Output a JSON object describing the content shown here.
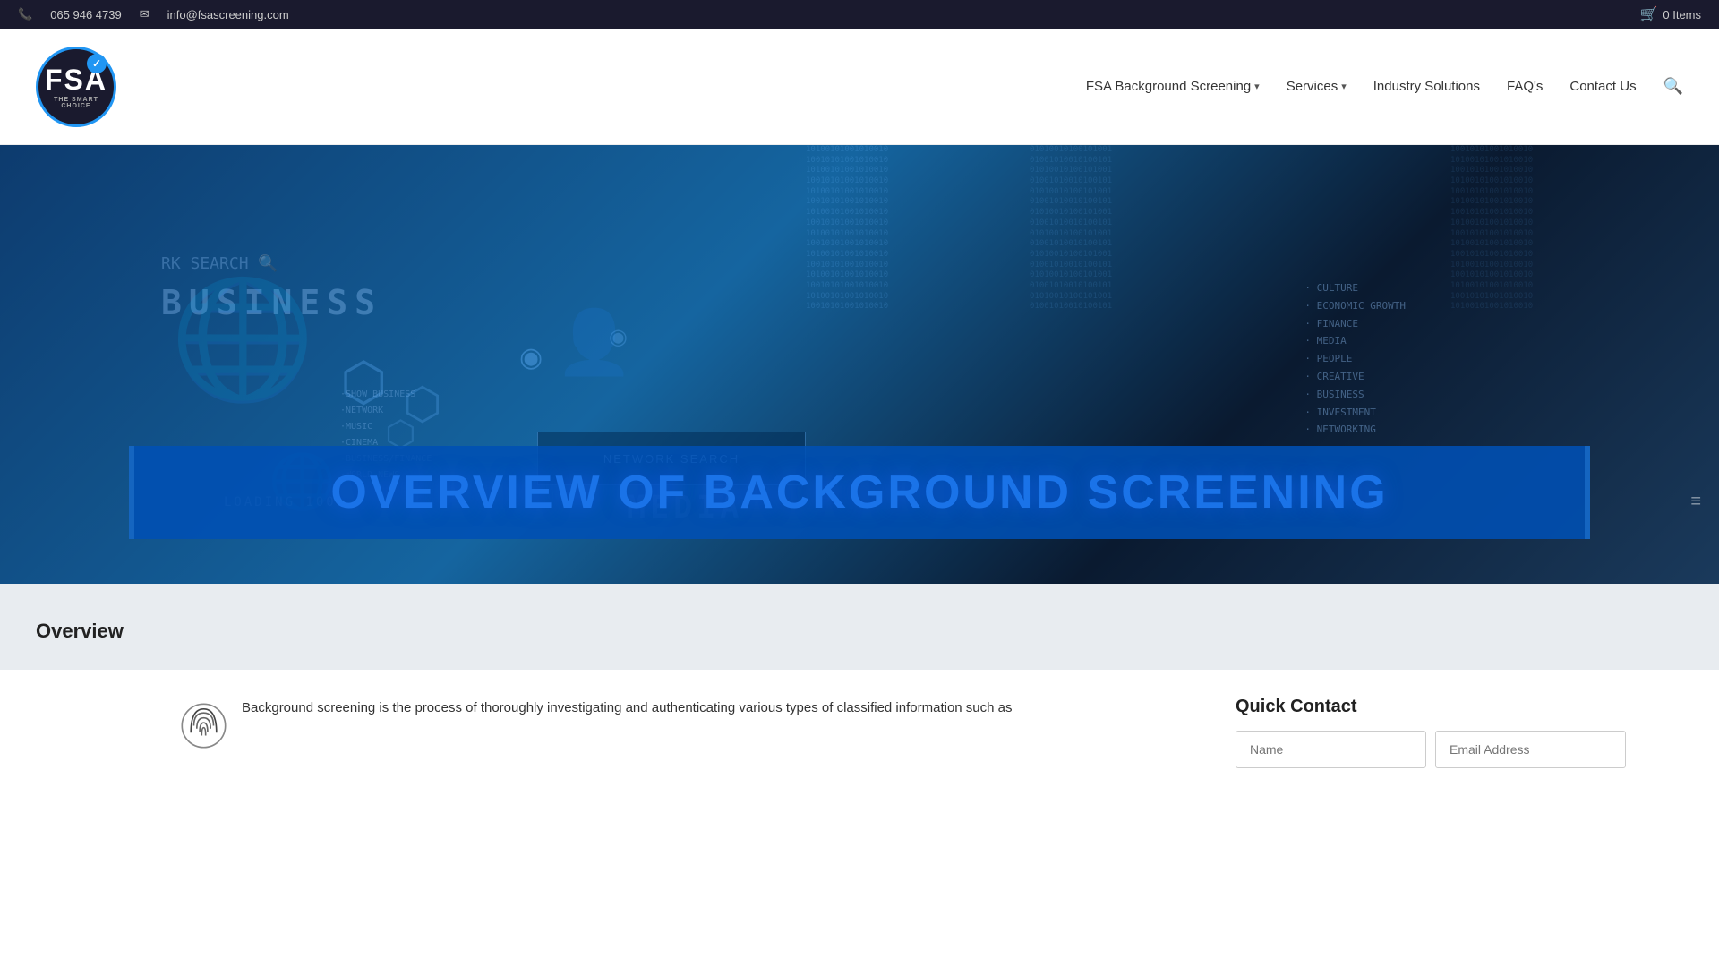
{
  "topbar": {
    "phone": "065 946 4739",
    "email": "info@fsascreening.com",
    "cart_label": "0 Items"
  },
  "header": {
    "logo_text": "FSA",
    "logo_tagline": "THE SMART CHOICE",
    "nav_items": [
      {
        "id": "fsa-bg-screening",
        "label": "FSA Background Screening",
        "has_arrow": true
      },
      {
        "id": "services",
        "label": "Services",
        "has_arrow": true
      },
      {
        "id": "industry-solutions",
        "label": "Industry Solutions",
        "has_arrow": false
      },
      {
        "id": "faqs",
        "label": "FAQ's",
        "has_arrow": false
      },
      {
        "id": "contact-us",
        "label": "Contact Us",
        "has_arrow": false
      }
    ]
  },
  "hero": {
    "banner_title": "OVERVIEW OF BACKGROUND SCREENING",
    "binary_text": "10100101001010010101001010010100101001010010101001010010100101001010010101001010010100101001010010101001010010100101001010010101001010010100101001010010",
    "hud_words": [
      "BUSINESS",
      "RK SEARCH",
      "MEDIA",
      "NETWORK",
      "LOADING 100%"
    ],
    "scroll_indicator": "≡"
  },
  "breadcrumb": {
    "label": "Overview"
  },
  "main": {
    "body_text": "Background screening is the process of thoroughly investigating and authenticating various types of classified information such as",
    "quick_contact": {
      "title": "Quick Contact",
      "name_placeholder": "Name",
      "email_placeholder": "Email Address"
    }
  }
}
